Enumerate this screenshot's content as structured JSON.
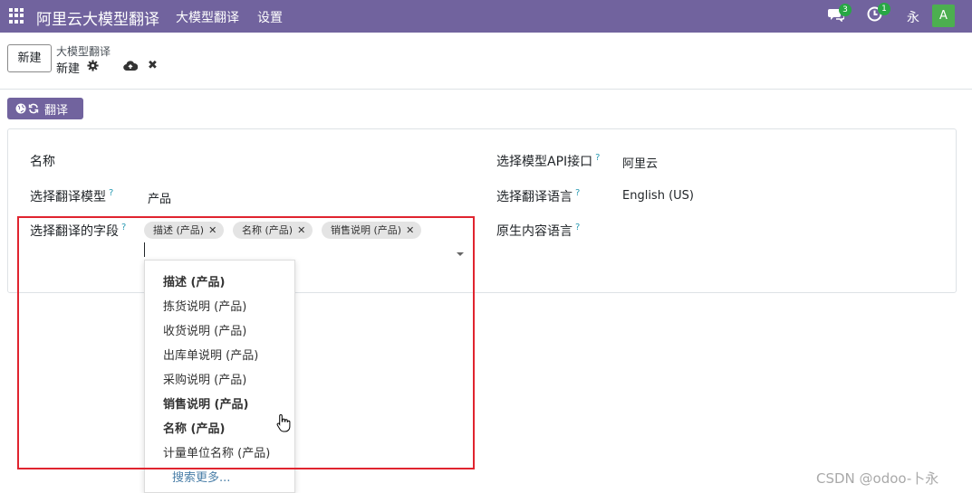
{
  "navbar": {
    "brand": "阿里云大模型翻译",
    "menu": [
      "大模型翻译",
      "设置"
    ],
    "chat_count": "3",
    "activity_count": "1",
    "company": "永",
    "avatar_initial": "A",
    "accent_color": "#71639e"
  },
  "control_panel": {
    "new_button": "新建",
    "breadcrumb_parent": "大模型翻译",
    "breadcrumb_current": "新建"
  },
  "action_bar": {
    "translate_button": "翻译"
  },
  "form": {
    "name_label": "名称",
    "model_label": "选择翻译模型",
    "model_value": "产品",
    "fields_label": "选择翻译的字段",
    "api_label": "选择模型API接口",
    "api_value": "阿里云",
    "lang_label": "选择翻译语言",
    "lang_value": "English (US)",
    "source_lang_label": "原生内容语言",
    "help_mark": "?",
    "tags": [
      "描述 (产品)",
      "名称 (产品)",
      "销售说明 (产品)"
    ]
  },
  "autocomplete": {
    "items": [
      {
        "label": "描述 (产品)",
        "bold": true
      },
      {
        "label": "拣货说明 (产品)",
        "bold": false
      },
      {
        "label": "收货说明 (产品)",
        "bold": false
      },
      {
        "label": "出库单说明 (产品)",
        "bold": false
      },
      {
        "label": "采购说明 (产品)",
        "bold": false
      },
      {
        "label": "销售说明 (产品)",
        "bold": true
      },
      {
        "label": "名称 (产品)",
        "bold": true
      },
      {
        "label": "计量单位名称 (产品)",
        "bold": false
      }
    ],
    "search_more": "搜索更多..."
  },
  "watermark": "CSDN @odoo-卜永"
}
